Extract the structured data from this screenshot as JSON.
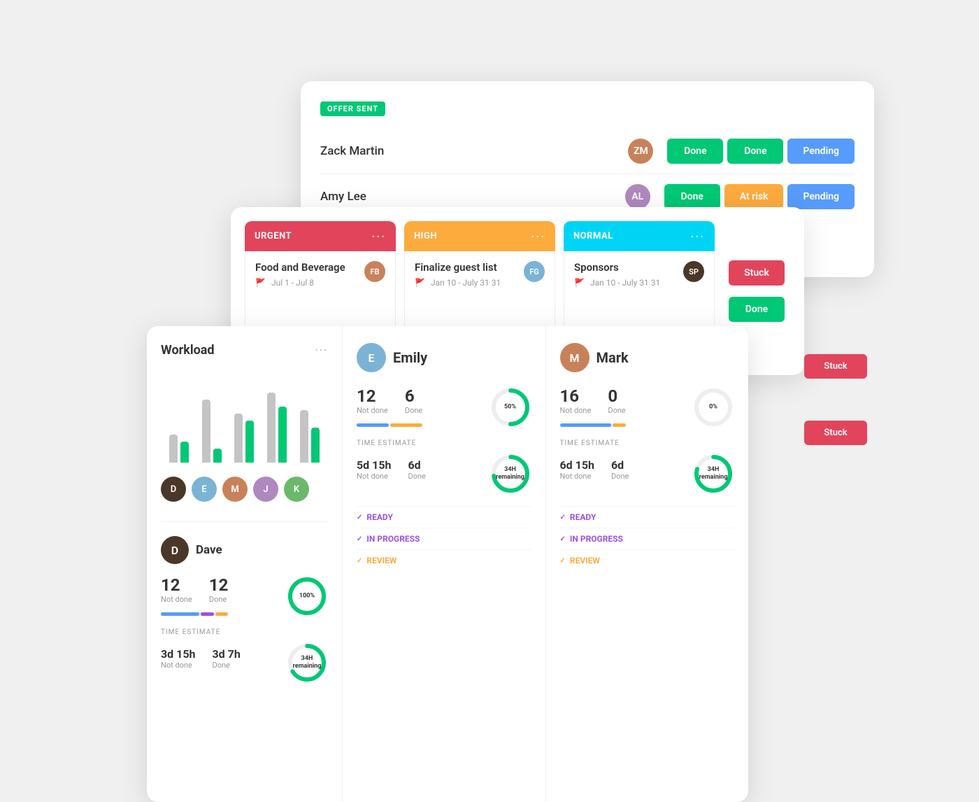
{
  "card_back": {
    "badge": "OFFER SENT",
    "rows": [
      {
        "name": "Zack Martin",
        "avatar_color": "#c8825a",
        "avatar_initials": "ZM",
        "pills": [
          {
            "label": "Done",
            "class": "pill-done"
          },
          {
            "label": "Done",
            "class": "pill-done"
          },
          {
            "label": "Pending",
            "class": "pill-pending"
          }
        ]
      },
      {
        "name": "Amy Lee",
        "avatar_color": "#b088c0",
        "avatar_initials": "AL",
        "pills": [
          {
            "label": "Done",
            "class": "pill-done"
          },
          {
            "label": "At risk",
            "class": "pill-atrisk"
          },
          {
            "label": "Pending",
            "class": "pill-pending"
          }
        ]
      }
    ]
  },
  "card_mid": {
    "columns": [
      {
        "header_class": "kanban-header-urgent",
        "header_label": "URGENT",
        "task_title": "Food and Beverage",
        "task_date": "Jul 1 - Jul 8",
        "flag_color": "#e2445c",
        "avatar_initials": "FB",
        "avatar_color": "#c8825a"
      },
      {
        "header_class": "kanban-header-high",
        "header_label": "HIGH",
        "task_title": "Finalize guest list",
        "task_date": "Jan 10 - July 31 31",
        "flag_color": "#fdab3d",
        "avatar_initials": "FG",
        "avatar_color": "#7bb3d4"
      },
      {
        "header_class": "kanban-header-normal",
        "header_label": "NORMAL",
        "task_title": "Sponsors",
        "task_date": "Jan 10 - July 31 31",
        "flag_color": "#aaa",
        "avatar_initials": "SP",
        "avatar_color": "#4a3728"
      }
    ],
    "stuck_pills": [
      {
        "label": "Stuck",
        "class": "pill-stuck"
      },
      {
        "label": "Done",
        "class": "pill-done"
      }
    ]
  },
  "card_front": {
    "workload": {
      "title": "Workload",
      "bars": [
        {
          "gray_h": 40,
          "green_h": 30
        },
        {
          "gray_h": 90,
          "green_h": 20
        },
        {
          "gray_h": 70,
          "green_h": 60
        },
        {
          "gray_h": 100,
          "green_h": 80
        },
        {
          "gray_h": 75,
          "green_h": 50
        }
      ],
      "avatars": [
        {
          "initials": "D",
          "color": "#4a3728"
        },
        {
          "initials": "E",
          "color": "#7bb3d4"
        },
        {
          "initials": "M",
          "color": "#c8825a"
        },
        {
          "initials": "J",
          "color": "#b088c0"
        },
        {
          "initials": "K",
          "color": "#6bb86b"
        }
      ],
      "dave": {
        "name": "Dave",
        "not_done": "12",
        "not_done_label": "Not done",
        "done": "12",
        "done_label": "Done",
        "donut_pct": 100,
        "donut_label": "100%",
        "time_estimate_label": "TIME ESTIMATE",
        "not_done_time": "3d 15h",
        "not_done_time_label": "Not done",
        "done_time": "3d 7h",
        "done_time_label": "Done",
        "remaining_label": "34H\nremaining"
      }
    },
    "emily": {
      "name": "Emily",
      "not_done": "12",
      "not_done_label": "Not done",
      "done": "6",
      "done_label": "Done",
      "donut_pct": 50,
      "donut_label": "50%",
      "time_estimate_label": "TIME ESTIMATE",
      "not_done_time": "5d 15h",
      "not_done_time_label": "Not done",
      "done_time": "6d",
      "done_time_label": "Done",
      "remaining_label": "34H\nremaining",
      "sections": [
        {
          "label": "READY",
          "color": "purple"
        },
        {
          "label": "IN PROGRESS",
          "color": "purple"
        },
        {
          "label": "REVIEW",
          "color": "orange"
        }
      ]
    },
    "mark": {
      "name": "Mark",
      "not_done": "16",
      "not_done_label": "Not done",
      "done": "0",
      "done_label": "Done",
      "donut_pct": 0,
      "donut_label": "0%",
      "time_estimate_label": "TIME ESTIMATE",
      "not_done_time": "6d 15h",
      "not_done_time_label": "Not done",
      "done_time": "6d",
      "done_time_label": "Done",
      "remaining_label": "34H\nremaining",
      "sections": [
        {
          "label": "READY",
          "color": "purple"
        },
        {
          "label": "IN PROGRESS",
          "color": "purple"
        },
        {
          "label": "REVIEW",
          "color": "orange"
        }
      ]
    }
  }
}
